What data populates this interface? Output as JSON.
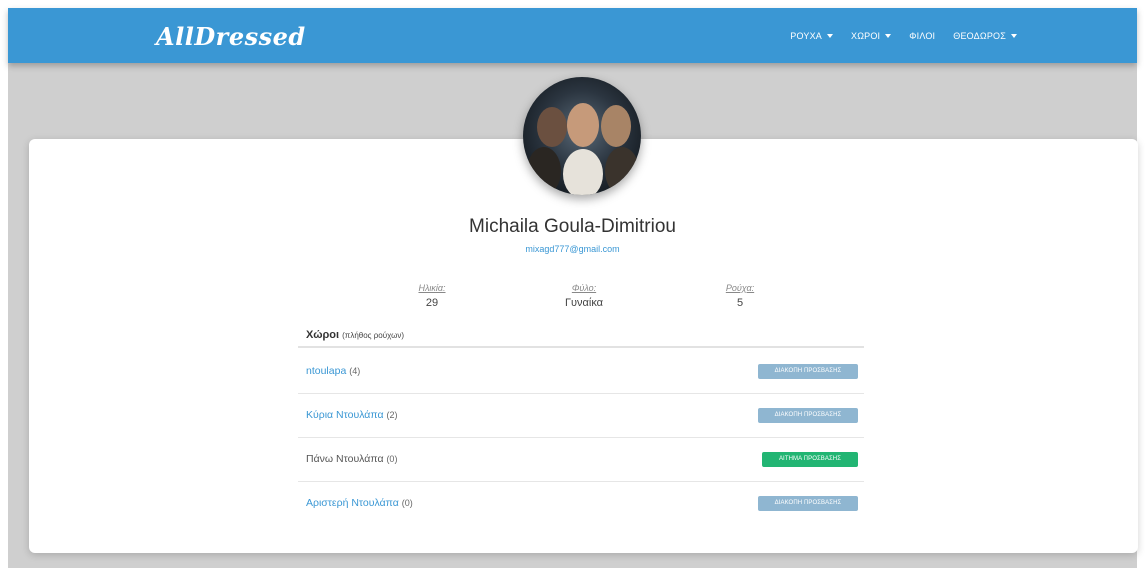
{
  "brand": {
    "logo_text": "AllDressed"
  },
  "nav": [
    {
      "label": "ΡΟΥΧΑ",
      "dropdown": true
    },
    {
      "label": "ΧΩΡΟΙ",
      "dropdown": true
    },
    {
      "label": "ΦΙΛΟΙ",
      "dropdown": false
    },
    {
      "label": "ΘΕΟΔΩΡΟΣ",
      "dropdown": true
    }
  ],
  "profile": {
    "name": "Michaila Goula-Dimitriou",
    "email": "mixagd777@gmail.com",
    "stats": [
      {
        "label": "Ηλικία:",
        "value": "29"
      },
      {
        "label": "Φύλο:",
        "value": "Γυναίκα"
      },
      {
        "label": "Ρούχα:",
        "value": "5"
      }
    ]
  },
  "spaces": {
    "title": "Χώροι",
    "subtitle": "(πλήθος ρούχων)",
    "items": [
      {
        "name": "ntoulapa",
        "count": "(4)",
        "is_link": true,
        "action": "ΔΙΑΚΟΠΗ ΠΡΟΣΒΑΣΗΣ",
        "action_type": "revoke"
      },
      {
        "name": "Κύρια Ντουλάπα",
        "count": "(2)",
        "is_link": true,
        "action": "ΔΙΑΚΟΠΗ ΠΡΟΣΒΑΣΗΣ",
        "action_type": "revoke"
      },
      {
        "name": "Πάνω Ντουλάπα",
        "count": "(0)",
        "is_link": false,
        "action": "ΑΙΤΗΜΑ ΠΡΟΣΒΑΣΗΣ",
        "action_type": "request"
      },
      {
        "name": "Αριστερή Ντουλάπα",
        "count": "(0)",
        "is_link": true,
        "action": "ΔΙΑΚΟΠΗ ΠΡΟΣΒΑΣΗΣ",
        "action_type": "revoke"
      }
    ]
  },
  "colors": {
    "navbar": "#3a97d4",
    "link": "#3a97d4",
    "revoke_button": "#8fb6d1",
    "request_button": "#22b573"
  }
}
